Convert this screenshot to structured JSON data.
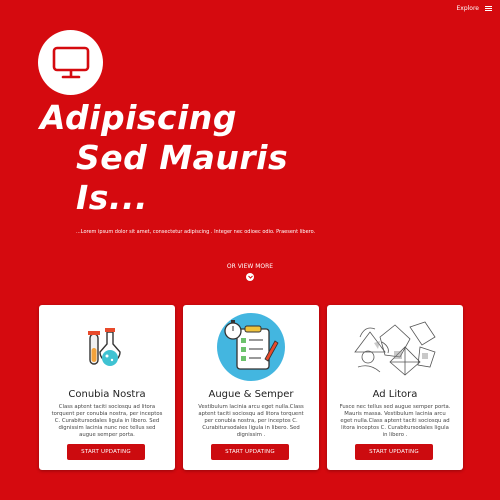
{
  "header": {
    "explore_label": "Explore"
  },
  "hero": {
    "title_line1": "Adipiscing",
    "title_line2": "Sed Mauris",
    "title_line3": "Is...",
    "text": "...Lorem ipsum dolor sit amet, consectetur adipiscing . Integer nec odioec odio. Praesent libero."
  },
  "view_more": {
    "label": "OR VIEW MORE"
  },
  "cards": [
    {
      "title": "Conubia Nostra",
      "text": "Class aptent taciti sociosqu ad litora torquent per conubia nostra, per inceptos C. Curabitursodales ligula in libero. Sed dignissim lacinia nunc nec tellus sed augue semper porta.",
      "button": "START UPDATING",
      "icon": "chemistry-flasks-icon"
    },
    {
      "title": "Augue & Semper",
      "text": "Vestibulum lacinia arcu eget nulla.Class aptent taciti sociosqu ad litora torquent per conubia nostra, per inceptos C. Curabitursodales ligula in libero. Sed dignissim .",
      "button": "START UPDATING",
      "icon": "clipboard-stopwatch-icon"
    },
    {
      "title": "Ad Litora",
      "text": "Fusce nec tellus sed augue semper porta. Mauris massa. Vestibulum lacinia arcu eget nulla.Class aptent taciti sociosqu ad litora inceptos C. Curabitursodales ligula in libero .",
      "button": "START UPDATING",
      "icon": "sketch-collage-icon"
    }
  ],
  "colors": {
    "background": "#d50a0f",
    "button": "#cc0b0f",
    "card": "#ffffff"
  }
}
